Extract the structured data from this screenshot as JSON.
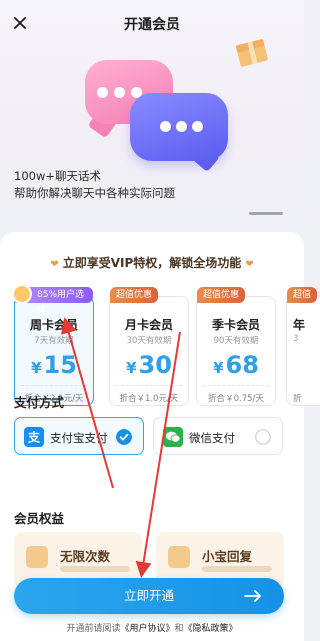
{
  "header": {
    "title": "开通会员"
  },
  "hero": {
    "line1": "100w+聊天话术",
    "line2": "帮助你解决聊天中各种实际问题"
  },
  "promo": {
    "text": "立即享受VIP特权，解锁全场功能"
  },
  "plans": [
    {
      "badge": "85%用户选择",
      "name": "周卡会员",
      "valid": "7天有效期",
      "currency": "¥",
      "price": "15",
      "unit_price": "折合￥2.1元/天",
      "selected": true
    },
    {
      "badge": "超值优惠",
      "name": "月卡会员",
      "valid": "30天有效期",
      "currency": "¥",
      "price": "30",
      "unit_price": "折合￥1.0元/天",
      "selected": false
    },
    {
      "badge": "超值优惠",
      "name": "季卡会员",
      "valid": "90天有效期",
      "currency": "¥",
      "price": "68",
      "unit_price": "折合￥0.75/天",
      "selected": false
    },
    {
      "badge": "超值",
      "name": "年",
      "valid": "3",
      "currency": "",
      "price": "",
      "unit_price": "折",
      "selected": false
    }
  ],
  "payment": {
    "title": "支付方式",
    "options": [
      {
        "label": "支付宝支付",
        "icon": "alipay-icon",
        "selected": true
      },
      {
        "label": "微信支付",
        "icon": "wechat-pay-icon",
        "selected": false
      }
    ]
  },
  "benefits": {
    "title": "会员权益",
    "items": [
      {
        "title": "无限次数"
      },
      {
        "title": "小宝回复"
      }
    ]
  },
  "cta": {
    "label": "立即开通"
  },
  "agreement": {
    "prefix": "开通前请阅读",
    "user_agreement": "《用户协议》",
    "and": "和",
    "privacy_policy": "《隐私政策》"
  },
  "colors": {
    "accent": "#1592e6",
    "badge_orange": "#d9633b",
    "badge_purple": "#8a5cf5",
    "annotation_red": "#e53935"
  }
}
